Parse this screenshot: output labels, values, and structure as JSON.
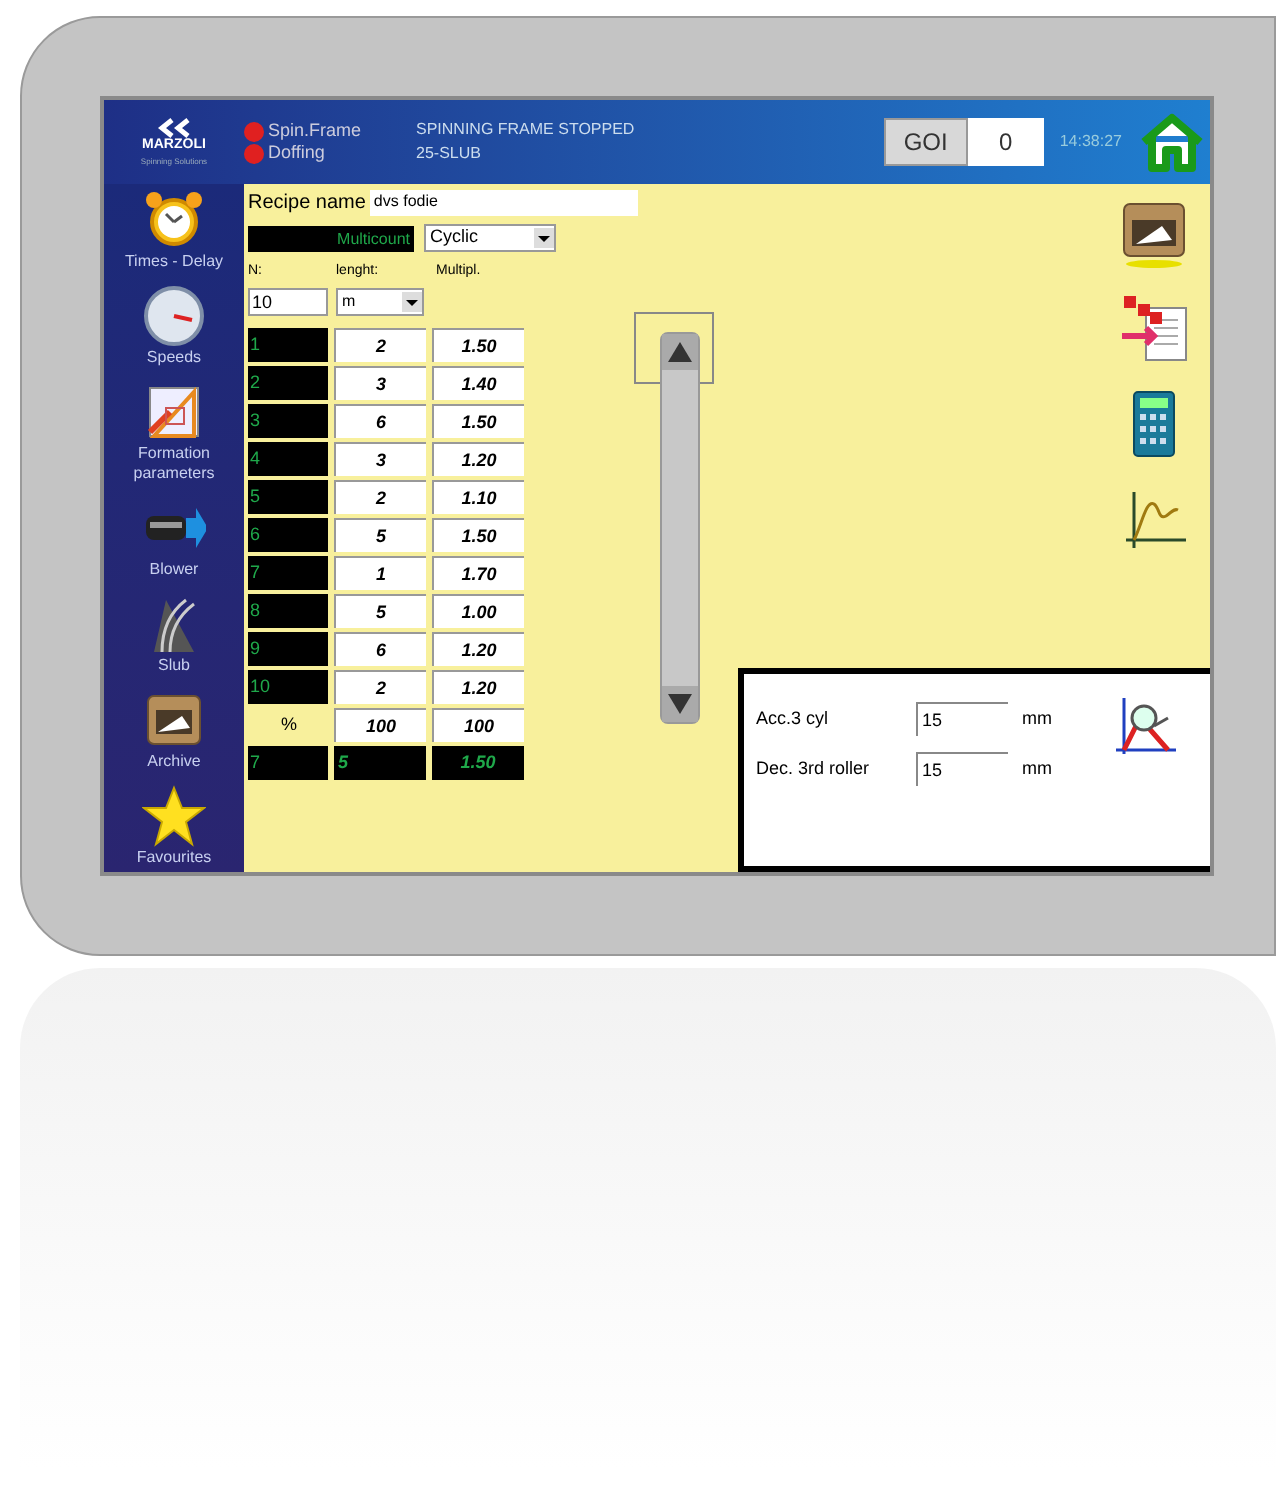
{
  "header": {
    "logo": {
      "brand": "MARZOLI",
      "tagline": "Spinning Solutions"
    },
    "indicators": [
      {
        "label": "Spin.Frame",
        "color": "#e02020"
      },
      {
        "label": "Doffing",
        "color": "#e02020"
      }
    ],
    "status": [
      "SPINNING FRAME STOPPED",
      "25-SLUB"
    ],
    "goi_button": "GOI",
    "counter": "0",
    "time": "14:38:27"
  },
  "sidebar": {
    "items": [
      {
        "kind": "clock",
        "label": "Times - Delay"
      },
      {
        "kind": "gauge",
        "label": "Speeds"
      },
      {
        "kind": "ruler",
        "label": "Formation parameters"
      },
      {
        "kind": "blower",
        "label": "Blower"
      },
      {
        "kind": "yarn",
        "label": "Slub"
      },
      {
        "kind": "drawer",
        "label": "Archive"
      },
      {
        "kind": "star",
        "label": "Favourites"
      }
    ]
  },
  "recipe": {
    "label": "Recipe name",
    "value": "dvs fodie",
    "mode_display": "Multicount",
    "mode_select": "Cyclic",
    "headers": [
      "N:",
      "lenght:",
      "Multipl."
    ],
    "n_value": "10",
    "unit": "m",
    "rows": [
      {
        "n": "1",
        "length": "2",
        "multiplier": "1.50"
      },
      {
        "n": "2",
        "length": "3",
        "multiplier": "1.40"
      },
      {
        "n": "3",
        "length": "6",
        "multiplier": "1.50"
      },
      {
        "n": "4",
        "length": "3",
        "multiplier": "1.20"
      },
      {
        "n": "5",
        "length": "2",
        "multiplier": "1.10"
      },
      {
        "n": "6",
        "length": "5",
        "multiplier": "1.50"
      },
      {
        "n": "7",
        "length": "1",
        "multiplier": "1.70"
      },
      {
        "n": "8",
        "length": "5",
        "multiplier": "1.00"
      },
      {
        "n": "9",
        "length": "6",
        "multiplier": "1.20"
      },
      {
        "n": "10",
        "length": "2",
        "multiplier": "1.20"
      }
    ],
    "percent_row": {
      "label": "%",
      "length": "100",
      "multiplier": "100"
    },
    "current_row": {
      "n": "7",
      "length": "5",
      "multiplier": "1.50"
    }
  },
  "tools": [
    {
      "kind": "drawer"
    },
    {
      "kind": "document"
    },
    {
      "kind": "calculator"
    },
    {
      "kind": "graph"
    }
  ],
  "panel": {
    "fields": [
      {
        "label": "Acc.3 cyl",
        "value": "15",
        "unit": "mm"
      },
      {
        "label": "Dec. 3rd roller",
        "value": "15",
        "unit": "mm"
      }
    ]
  }
}
